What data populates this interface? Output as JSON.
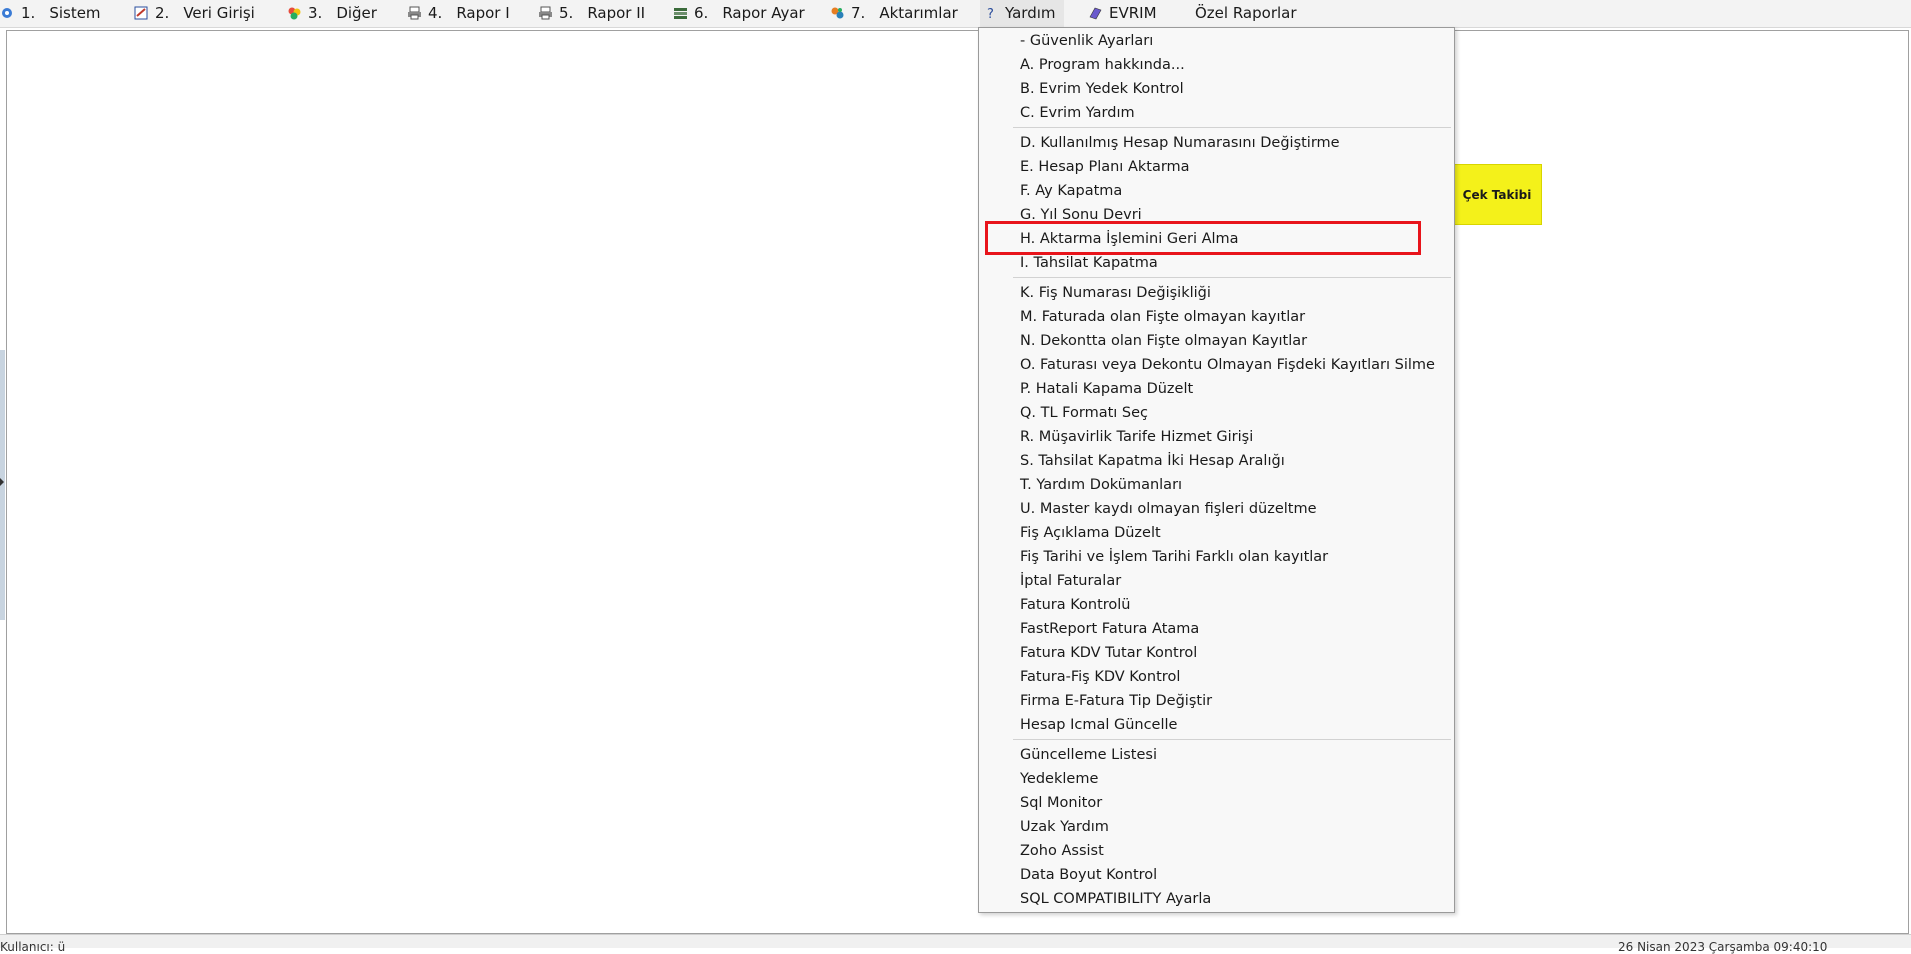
{
  "menubar": {
    "items": [
      {
        "num": "1.",
        "label": "Sistem",
        "icon": "system-icon"
      },
      {
        "num": "2.",
        "label": "Veri Girişi",
        "icon": "data-entry-icon"
      },
      {
        "num": "3.",
        "label": "Diğer",
        "icon": "other-icon"
      },
      {
        "num": "4.",
        "label": "Rapor I",
        "icon": "printer-icon"
      },
      {
        "num": "5.",
        "label": "Rapor II",
        "icon": "printer-icon"
      },
      {
        "num": "6.",
        "label": "Rapor Ayar",
        "icon": "report-settings-icon"
      },
      {
        "num": "7.",
        "label": "Aktarımlar",
        "icon": "transfer-icon"
      },
      {
        "num": "",
        "label": "Yardım",
        "icon": "help-icon"
      },
      {
        "num": "",
        "label": "EVRIM",
        "icon": "evrim-icon"
      },
      {
        "num": "",
        "label": "Özel Raporlar",
        "icon": ""
      }
    ]
  },
  "tile": {
    "label": "Çek Takibi",
    "color": "#f4f11a"
  },
  "dropdown": {
    "items": [
      "- Güvenlik Ayarları",
      "A.   Program hakkında...",
      "B.   Evrim Yedek Kontrol",
      "C.   Evrim Yardım",
      "D.   Kullanılmış Hesap Numarasını Değiştirme",
      "E.   Hesap Planı Aktarma",
      "F.   Ay Kapatma",
      "G.   Yıl Sonu Devri",
      "H.   Aktarma İşlemini Geri Alma",
      "I.   Tahsilat Kapatma",
      "K.  Fiş Numarası Değişikliği",
      "M. Faturada olan Fişte olmayan kayıtlar",
      "N.  Dekontta olan Fişte olmayan Kayıtlar",
      "O. Faturası veya Dekontu Olmayan Fişdeki Kayıtları Silme",
      "P. Hatali Kapama Düzelt",
      "Q. TL Formatı Seç",
      "R. Müşavirlik Tarife Hizmet Girişi",
      "S.   Tahsilat Kapatma İki Hesap Aralığı",
      "T. Yardım Dokümanları",
      "U. Master kaydı olmayan fişleri düzeltme",
      "Fiş Açıklama Düzelt",
      "Fiş Tarihi ve İşlem Tarihi Farklı olan kayıtlar",
      "İptal Faturalar",
      "Fatura Kontrolü",
      "FastReport Fatura Atama",
      "Fatura KDV Tutar Kontrol",
      "Fatura-Fiş KDV Kontrol",
      "Firma E-Fatura Tip Değiştir",
      "Hesap Icmal Güncelle",
      "Güncelleme Listesi",
      "Yedekleme",
      "Sql Monitor",
      "Uzak Yardım",
      "Zoho Assist",
      "Data Boyut Kontrol",
      "SQL COMPATIBILITY Ayarla"
    ],
    "highlighted_index": 8,
    "highlight_color": "#e8141b"
  },
  "statusbar": {
    "left": "Kullanıcı: ü",
    "right": "26 Nisan 2023 Çarşamba 09:40:10"
  }
}
